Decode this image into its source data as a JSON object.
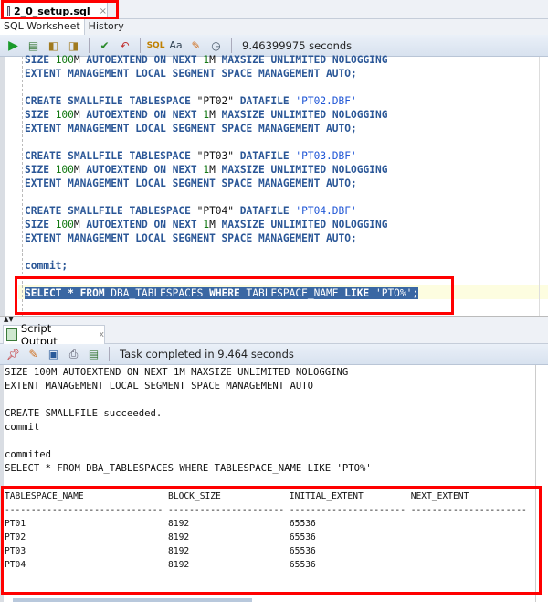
{
  "file_tab": {
    "label": "2_0_setup.sql",
    "close": "×"
  },
  "subtabs": [
    "SQL Worksheet",
    "History"
  ],
  "toolbar": {
    "icons": [
      "run-statement-icon",
      "run-script-icon",
      "autotrace-icon",
      "explain-plan-icon",
      "commit-icon",
      "rollback-icon",
      "sql-tuning-icon",
      "format-case-icon",
      "clear-eraser-icon",
      "history-clock-icon"
    ],
    "elapsed": "9.46399975 seconds"
  },
  "editor_lines": [
    [
      [
        "SIZE ",
        "k"
      ],
      [
        "100",
        "n"
      ],
      [
        "M",
        "p"
      ],
      [
        " AUTOEXTEND ON NEXT ",
        "k"
      ],
      [
        "1",
        "n"
      ],
      [
        "M",
        "p"
      ],
      [
        " MAXSIZE UNLIMITED NOLOGGING",
        "k"
      ]
    ],
    [
      [
        "EXTENT MANAGEMENT LOCAL SEGMENT SPACE MANAGEMENT AUTO;",
        "k"
      ]
    ],
    [],
    [
      [
        "CREATE SMALLFILE TABLESPACE ",
        "k"
      ],
      [
        "\"PT02\"",
        "p"
      ],
      [
        " DATAFILE ",
        "k"
      ],
      [
        "'PT02.DBF'",
        "s"
      ]
    ],
    [
      [
        "SIZE ",
        "k"
      ],
      [
        "100",
        "n"
      ],
      [
        "M",
        "p"
      ],
      [
        " AUTOEXTEND ON NEXT ",
        "k"
      ],
      [
        "1",
        "n"
      ],
      [
        "M",
        "p"
      ],
      [
        " MAXSIZE UNLIMITED NOLOGGING",
        "k"
      ]
    ],
    [
      [
        "EXTENT MANAGEMENT LOCAL SEGMENT SPACE MANAGEMENT AUTO;",
        "k"
      ]
    ],
    [],
    [
      [
        "CREATE SMALLFILE TABLESPACE ",
        "k"
      ],
      [
        "\"PT03\"",
        "p"
      ],
      [
        " DATAFILE ",
        "k"
      ],
      [
        "'PT03.DBF'",
        "s"
      ]
    ],
    [
      [
        "SIZE ",
        "k"
      ],
      [
        "100",
        "n"
      ],
      [
        "M",
        "p"
      ],
      [
        " AUTOEXTEND ON NEXT ",
        "k"
      ],
      [
        "1",
        "n"
      ],
      [
        "M",
        "p"
      ],
      [
        " MAXSIZE UNLIMITED NOLOGGING",
        "k"
      ]
    ],
    [
      [
        "EXTENT MANAGEMENT LOCAL SEGMENT SPACE MANAGEMENT AUTO;",
        "k"
      ]
    ],
    [],
    [
      [
        "CREATE SMALLFILE TABLESPACE ",
        "k"
      ],
      [
        "\"PT04\"",
        "p"
      ],
      [
        " DATAFILE ",
        "k"
      ],
      [
        "'PT04.DBF'",
        "s"
      ]
    ],
    [
      [
        "SIZE ",
        "k"
      ],
      [
        "100",
        "n"
      ],
      [
        "M",
        "p"
      ],
      [
        " AUTOEXTEND ON NEXT ",
        "k"
      ],
      [
        "1",
        "n"
      ],
      [
        "M",
        "p"
      ],
      [
        " MAXSIZE UNLIMITED NOLOGGING",
        "k"
      ]
    ],
    [
      [
        "EXTENT MANAGEMENT LOCAL SEGMENT SPACE MANAGEMENT AUTO;",
        "k"
      ]
    ],
    [],
    [
      [
        "commit;",
        "k"
      ]
    ],
    [],
    [
      [
        "SELECT * FROM ",
        "k"
      ],
      [
        "DBA_TABLESPACES ",
        "p"
      ],
      [
        "WHERE ",
        "k"
      ],
      [
        "TABLESPACE_NAME ",
        "p"
      ],
      [
        "LIKE ",
        "k"
      ],
      [
        "'PTO%'",
        "s"
      ],
      [
        ";",
        "p"
      ]
    ]
  ],
  "selected_line": 17,
  "output_tab": {
    "label": "Script Output",
    "close": "x"
  },
  "output_toolbar": {
    "icons": [
      "pin-icon",
      "clear-eraser-icon",
      "save-icon",
      "print-icon",
      "script-icon"
    ],
    "status": "Task completed in 9.464 seconds"
  },
  "output_lines": [
    "SIZE 100M AUTOEXTEND ON NEXT 1M MAXSIZE UNLIMITED NOLOGGING",
    "EXTENT MANAGEMENT LOCAL SEGMENT SPACE MANAGEMENT AUTO",
    "",
    "CREATE SMALLFILE succeeded.",
    "commit",
    "",
    "commited",
    "SELECT * FROM DBA_TABLESPACES WHERE TABLESPACE_NAME LIKE 'PTO%'",
    "",
    "TABLESPACE_NAME                BLOCK_SIZE             INITIAL_EXTENT         NEXT_EXTENT",
    "------------------------------ ---------------------- ---------------------- ----------------------",
    "PT01                           8192                   65536",
    "PT02                           8192                   65536",
    "PT03                           8192                   65536",
    "PT04                           8192                   65536"
  ]
}
